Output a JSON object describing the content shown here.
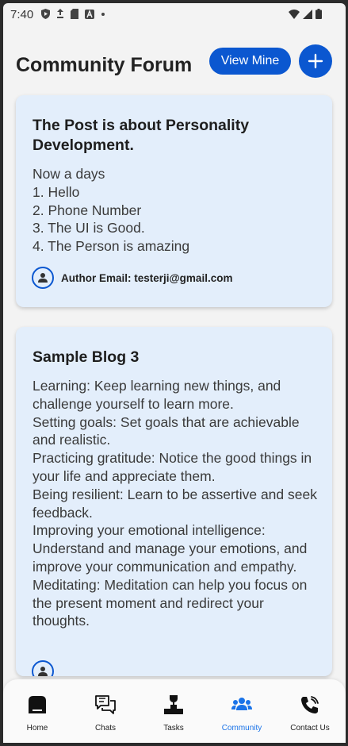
{
  "status_bar": {
    "time": "7:40"
  },
  "header": {
    "title": "Community Forum",
    "view_mine_label": "View Mine",
    "add_icon": "plus-icon"
  },
  "posts": [
    {
      "title": "The Post is about Personality Development.",
      "body": "Now a days\n1. Hello\n2. Phone Number\n3. The UI is Good.\n4. The Person is amazing",
      "author": "Author Email: testerji@gmail.com"
    },
    {
      "title": "Sample Blog 3",
      "body": "Learning: Keep learning new things, and challenge yourself to learn more.\nSetting goals: Set goals that are achievable and realistic.\nPracticing gratitude: Notice the good things in your life and appreciate them.\nBeing resilient: Learn to be assertive and seek feedback.\nImproving your emotional intelligence: Understand and manage your emotions, and improve your communication and empathy.\nMeditating: Meditation can help you focus on the present moment and redirect your thoughts."
    }
  ],
  "bottom_nav": {
    "items": [
      {
        "label": "Home",
        "icon": "home-icon"
      },
      {
        "label": "Chats",
        "icon": "chat-icon"
      },
      {
        "label": "Tasks",
        "icon": "tasks-icon"
      },
      {
        "label": "Community",
        "icon": "community-icon"
      },
      {
        "label": "Contact Us",
        "icon": "phone-icon"
      }
    ],
    "active": "Community"
  },
  "colors": {
    "accent": "#0b57d0",
    "card_bg": "#e3eefb",
    "active_nav": "#1a73e8"
  }
}
